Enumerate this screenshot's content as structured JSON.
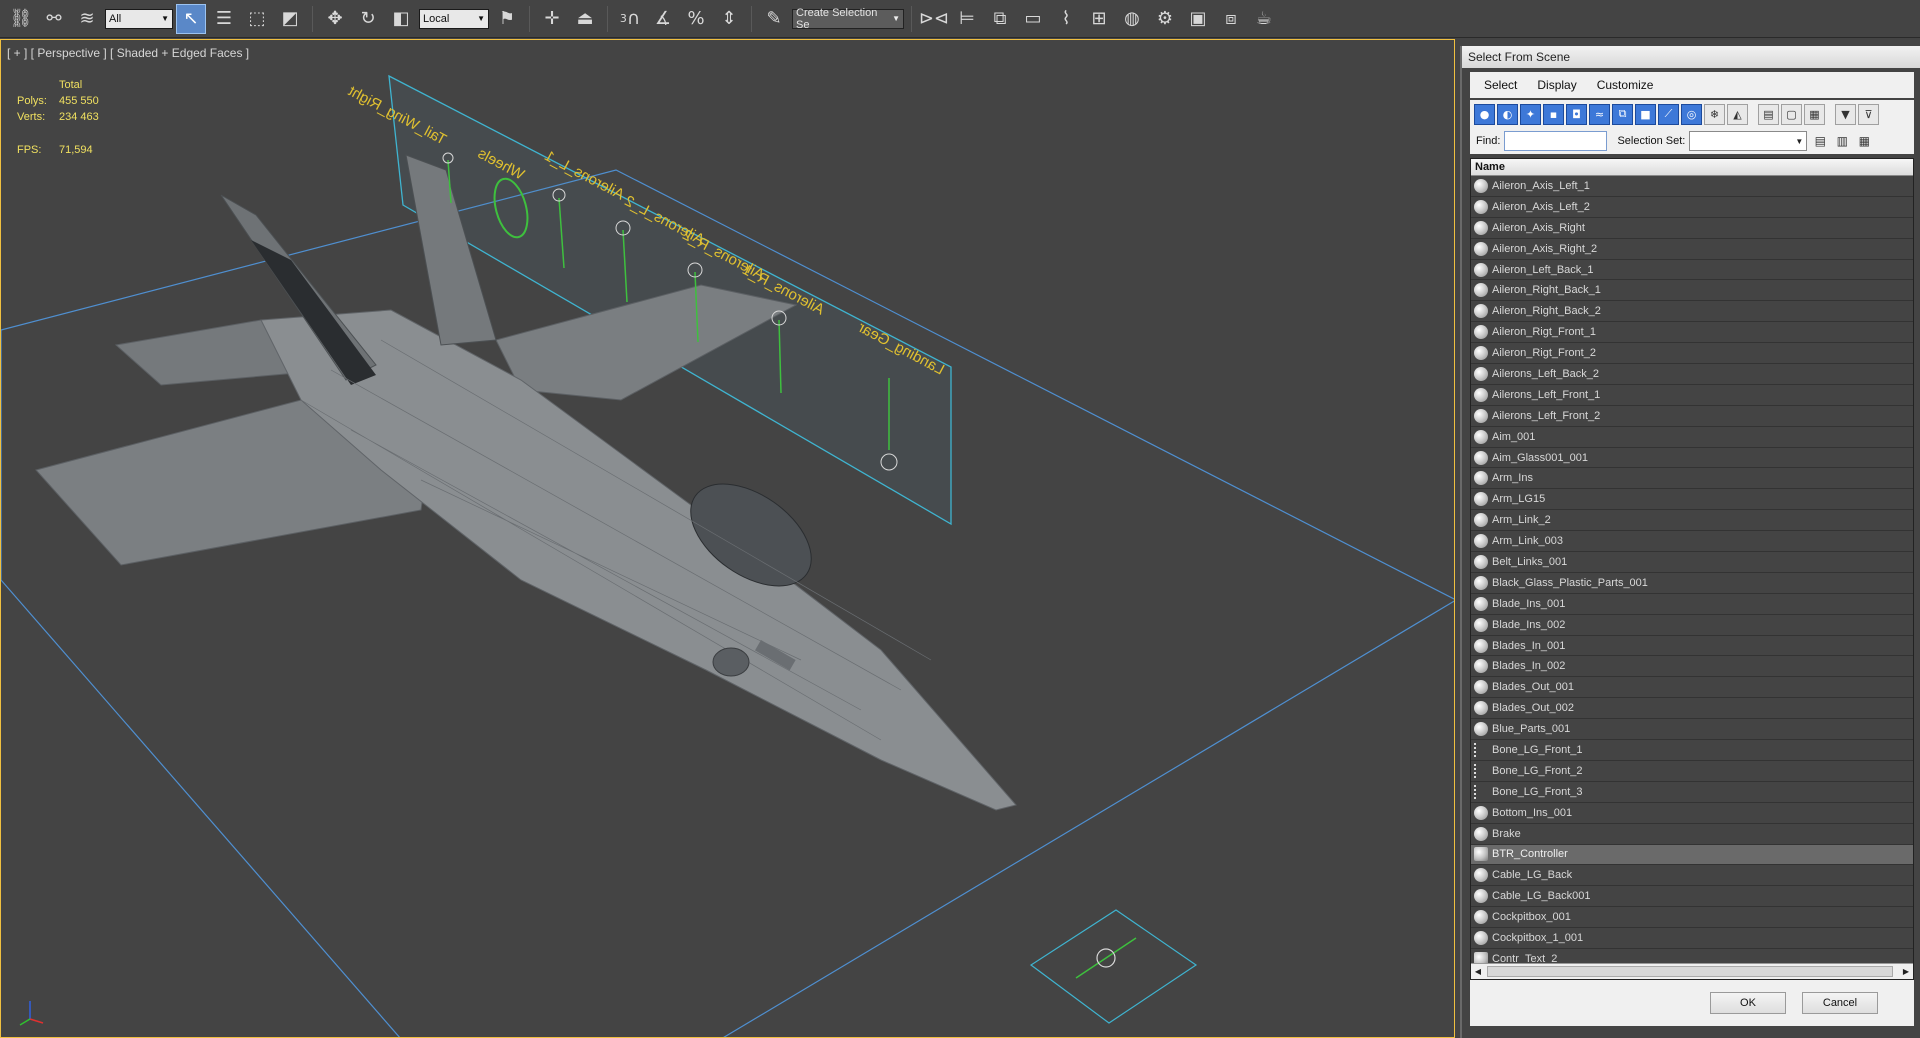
{
  "toolbar": {
    "filter_value": "All",
    "coord_value": "Local",
    "snap_label": "3",
    "selection_set_placeholder": "Create Selection Se",
    "icons": [
      "link-icon",
      "unlink-icon",
      "bind-space-warp-icon",
      "select-icon",
      "select-by-name-icon",
      "rect-selection-icon",
      "window-crossing-icon",
      "move-icon",
      "rotate-icon",
      "scale-icon",
      "mirror-icon",
      "align-icon",
      "layer-icon",
      "curve-editor-icon",
      "schematic-view-icon",
      "material-editor-icon",
      "render-setup-icon",
      "rendered-frame-icon",
      "render-icon",
      "teapot-icon"
    ]
  },
  "viewport": {
    "label": "[ + ] [ Perspective ] [ Shaded + Edged Faces ]",
    "stats": {
      "header": "Total",
      "polys_label": "Polys:",
      "polys_value": "455 550",
      "verts_label": "Verts:",
      "verts_value": "234 463",
      "fps_label": "FPS:",
      "fps_value": "71,594"
    },
    "controller_labels": [
      "Tail_Wing_Right",
      "Wheels",
      "Ailerons_L_1",
      "Ailerons_L_2",
      "Ailerons_R_2",
      "Ailerons_R_1",
      "Landing_Gear"
    ]
  },
  "dialog": {
    "title": "Select From Scene",
    "menu": [
      "Select",
      "Display",
      "Customize"
    ],
    "find_label": "Find:",
    "selection_set_label": "Selection Set:",
    "column_name": "Name",
    "items": [
      "Aileron_Axis_Left_1",
      "Aileron_Axis_Left_2",
      "Aileron_Axis_Right",
      "Aileron_Axis_Right_2",
      "Aileron_Left_Back_1",
      "Aileron_Right_Back_1",
      "Aileron_Right_Back_2",
      "Aileron_Rigt_Front_1",
      "Aileron_Rigt_Front_2",
      "Ailerons_Left_Back_2",
      "Ailerons_Left_Front_1",
      "Ailerons_Left_Front_2",
      "Aim_001",
      "Aim_Glass001_001",
      "Arm_Ins",
      "Arm_LG15",
      "Arm_Link_2",
      "Arm_Link_003",
      "Belt_Links_001",
      "Black_Glass_Plastic_Parts_001",
      "Blade_Ins_001",
      "Blade_Ins_002",
      "Blades_In_001",
      "Blades_In_002",
      "Blades_Out_001",
      "Blades_Out_002",
      "Blue_Parts_001",
      "Bone_LG_Front_1",
      "Bone_LG_Front_2",
      "Bone_LG_Front_3",
      "Bottom_Ins_001",
      "Brake",
      "BTR_Controller",
      "Cable_LG_Back",
      "Cable_LG_Back001",
      "Cockpitbox_001",
      "Cockpitbox_1_001",
      "Contr_Text_2"
    ],
    "selected_item": "BTR_Controller",
    "ok_label": "OK",
    "cancel_label": "Cancel"
  }
}
